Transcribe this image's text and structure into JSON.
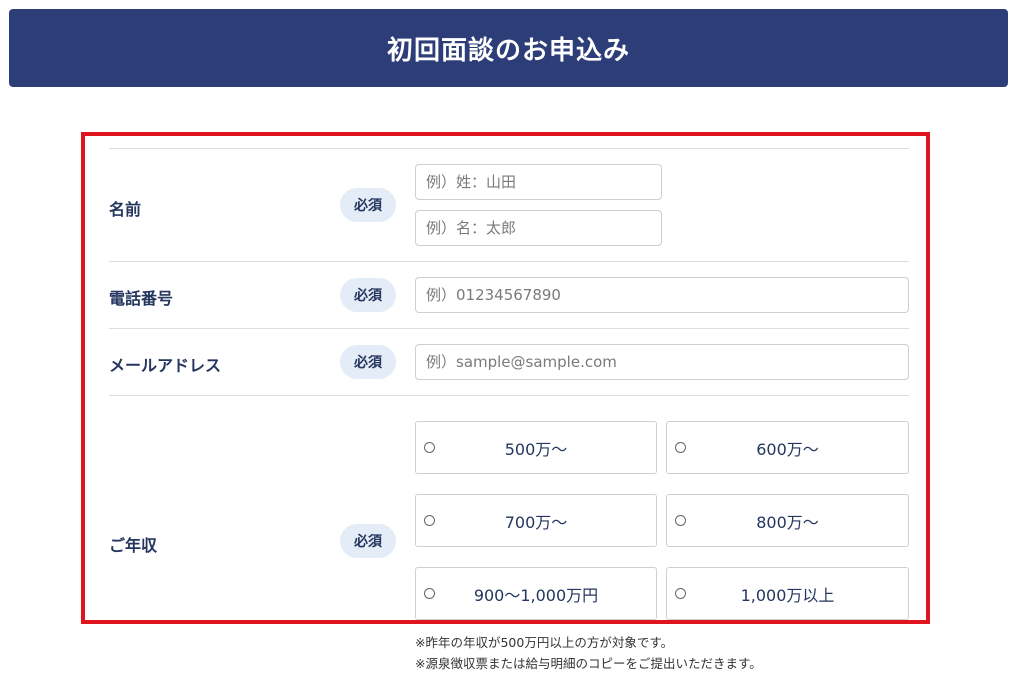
{
  "header": {
    "title": "初回面談のお申込み"
  },
  "required_label": "必須",
  "fields": {
    "name": {
      "label": "名前",
      "last_placeholder": "例）姓：山田",
      "first_placeholder": "例）名：太郎"
    },
    "phone": {
      "label": "電話番号",
      "placeholder": "例）01234567890"
    },
    "email": {
      "label": "メールアドレス",
      "placeholder": "例）sample@sample.com"
    },
    "income": {
      "label": "ご年収",
      "options": [
        "500万〜",
        "600万〜",
        "700万〜",
        "800万〜",
        "900〜1,000万円",
        "1,000万以上"
      ]
    }
  },
  "notes": [
    "※昨年の年収が500万円以上の方が対象です。",
    "※源泉徴収票または給与明細のコピーをご提出いただきます。"
  ],
  "colors": {
    "header_bg": "#2c3d78",
    "accent_text": "#24365f",
    "badge_bg": "#e4ecf7",
    "highlight_border": "#e0141e"
  }
}
